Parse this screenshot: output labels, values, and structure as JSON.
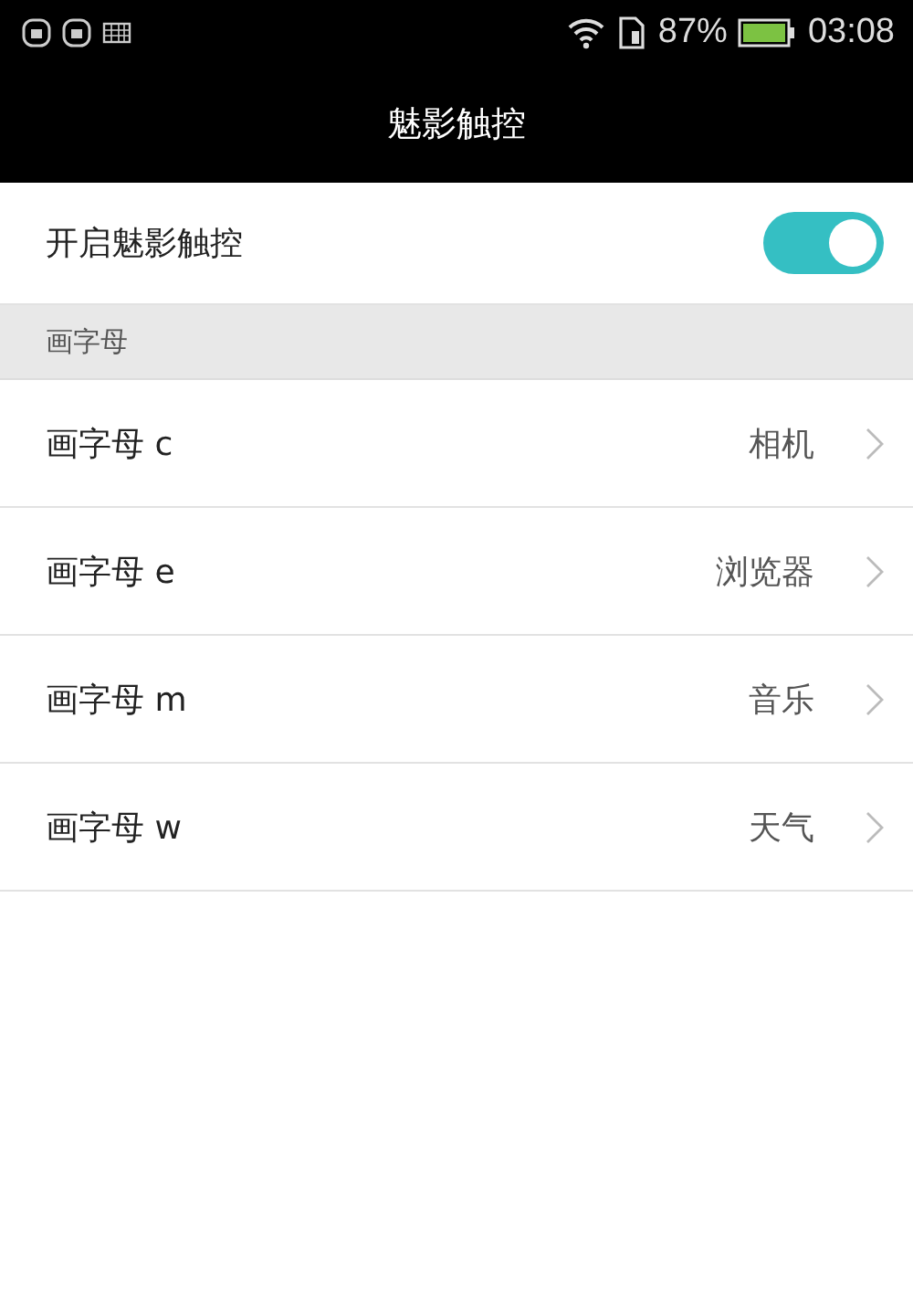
{
  "status_bar": {
    "battery_percent": "87%",
    "time": "03:08"
  },
  "title": "魅影触控",
  "toggle": {
    "label": "开启魅影触控",
    "on": true
  },
  "section": {
    "header": "画字母"
  },
  "rows": [
    {
      "label": "画字母 c",
      "value": "相机"
    },
    {
      "label": "画字母 e",
      "value": "浏览器"
    },
    {
      "label": "画字母 m",
      "value": "音乐"
    },
    {
      "label": "画字母 w",
      "value": "天气"
    }
  ]
}
